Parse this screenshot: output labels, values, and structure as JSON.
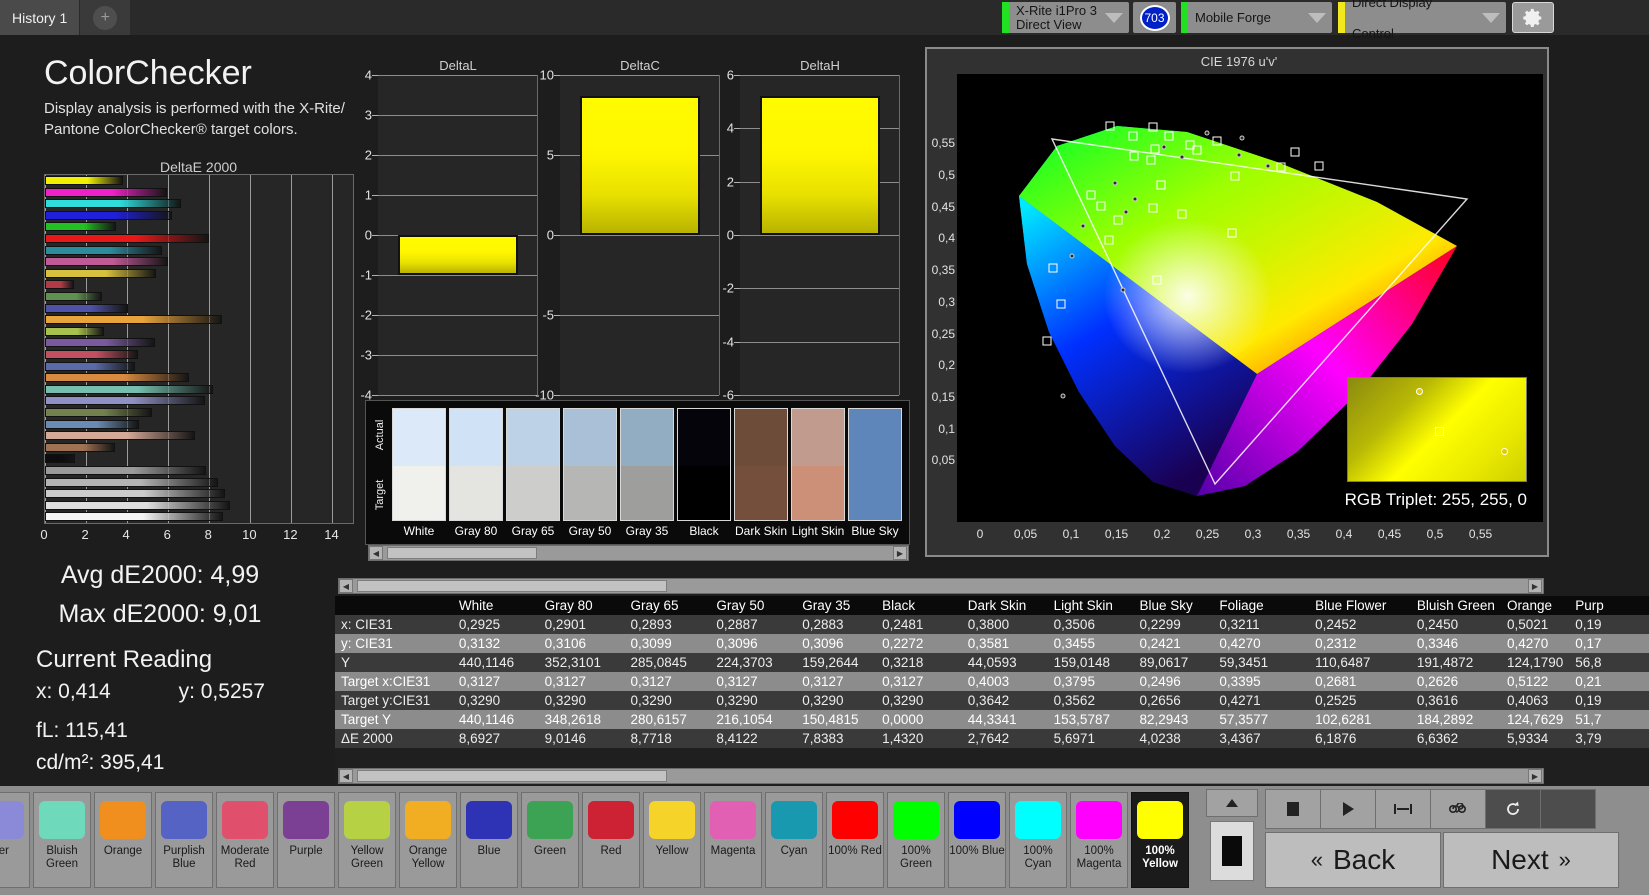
{
  "topbar": {
    "tab_label": "History 1",
    "add_tab_label": "+",
    "device": {
      "line1": "X-Rite i1Pro 3",
      "line2": "Direct View",
      "serial": "703"
    },
    "pattern_source": "Mobile Forge",
    "display_control": "Direct Display Control",
    "gear_icon": "gear-icon"
  },
  "left": {
    "title": "ColorChecker",
    "subtitle": "Display analysis is performed with the X-Rite/ Pantone ColorChecker® target colors.",
    "avg_de2000": "Avg dE2000: 4,99",
    "max_de2000": "Max dE2000: 9,01",
    "current_reading_label": "Current Reading",
    "x_label": "x: 0,414",
    "y_label": "y: 0,5257",
    "fl_label": "fL: 115,41",
    "cd_label": "cd/m²: 395,41"
  },
  "chart_data": [
    {
      "type": "bar",
      "orientation": "horizontal",
      "title": "DeltaE 2000",
      "xlabel": "",
      "ylabel": "",
      "xlim": [
        0,
        15
      ],
      "ticks": [
        0,
        2,
        4,
        6,
        8,
        10,
        12,
        14
      ],
      "grid": true,
      "categories": [
        "100% Yellow",
        "100% Magenta",
        "100% Cyan",
        "100% Blue",
        "100% Green",
        "100% Red",
        "Cyan",
        "Magenta",
        "Yellow",
        "Red",
        "Green",
        "Blue",
        "Orange Yellow",
        "Yellow Green",
        "Purple",
        "Moderate Red",
        "Purplish Blue",
        "Orange",
        "Bluish Green",
        "Blue Flower",
        "Foliage",
        "Blue Sky",
        "Light Skin",
        "Dark Skin",
        "Black",
        "Gray 35",
        "Gray 50",
        "Gray 65",
        "Gray 80",
        "White"
      ],
      "values": [
        3.79,
        5.93,
        6.64,
        6.19,
        3.44,
        8.0,
        5.7,
        6.0,
        5.4,
        1.43,
        2.76,
        4.02,
        8.6,
        2.85,
        5.35,
        4.55,
        4.4,
        7.0,
        8.2,
        7.8,
        5.2,
        4.6,
        7.3,
        3.4,
        1.45,
        7.84,
        8.41,
        8.77,
        9.01,
        8.69
      ],
      "bar_colors": [
        "#f0f000",
        "#f020c8",
        "#30dcdc",
        "#2020d8",
        "#22c022",
        "#e81818",
        "#2d8b9e",
        "#c05a96",
        "#d6c03e",
        "#b03a46",
        "#5f9050",
        "#4f52a8",
        "#e8a33d",
        "#a8c04d",
        "#7a5a9e",
        "#c15060",
        "#5a6aa8",
        "#d88a40",
        "#76bfae",
        "#8f90c4",
        "#73814e",
        "#6a8cb4",
        "#d4a998",
        "#a07254",
        "#0d0d0d",
        "#9a9a9a",
        "#b4b4b4",
        "#cccccc",
        "#dedede",
        "#f4f4f4"
      ]
    },
    {
      "type": "bar",
      "title": "DeltaL",
      "ylim": [
        -4,
        4
      ],
      "ticks": [
        4,
        3,
        2,
        1,
        0,
        -1,
        -2,
        -3,
        -4
      ],
      "values": [
        -1.0
      ],
      "bar_color": "#fff000"
    },
    {
      "type": "bar",
      "title": "DeltaC",
      "ylim": [
        -10,
        10
      ],
      "ticks": [
        10,
        5,
        0,
        -5,
        -10
      ],
      "values": [
        8.7
      ],
      "bar_color": "#fff000"
    },
    {
      "type": "bar",
      "title": "DeltaH",
      "ylim": [
        -6,
        6
      ],
      "ticks": [
        6,
        4,
        2,
        0,
        -2,
        -4,
        -6
      ],
      "values": [
        5.2
      ],
      "bar_color": "#fff000"
    },
    {
      "type": "scatter",
      "title": "CIE 1976 u'v'",
      "xlabel": "",
      "ylabel": "",
      "xticks": [
        "0",
        "0,05",
        "0,1",
        "0,15",
        "0,2",
        "0,25",
        "0,3",
        "0,35",
        "0,4",
        "0,45",
        "0,5",
        "0,55"
      ],
      "yticks": [
        "0,55",
        "0,5",
        "0,45",
        "0,4",
        "0,35",
        "0,3",
        "0,25",
        "0,2",
        "0,15",
        "0,1",
        "0,05"
      ],
      "rgb_triplet_label": "RGB Triplet: 255, 255, 0",
      "measured_points": [
        [
          0.148,
          0.578
        ],
        [
          0.196,
          0.576
        ],
        [
          0.255,
          0.566
        ],
        [
          0.174,
          0.561
        ],
        [
          0.213,
          0.561
        ],
        [
          0.293,
          0.559
        ],
        [
          0.266,
          0.554
        ],
        [
          0.236,
          0.548
        ],
        [
          0.208,
          0.545
        ],
        [
          0.198,
          0.541
        ],
        [
          0.244,
          0.54
        ],
        [
          0.29,
          0.531
        ],
        [
          0.352,
          0.537
        ],
        [
          0.175,
          0.53
        ],
        [
          0.228,
          0.529
        ],
        [
          0.193,
          0.524
        ],
        [
          0.378,
          0.515
        ],
        [
          0.322,
          0.514
        ],
        [
          0.336,
          0.512
        ],
        [
          0.286,
          0.498
        ],
        [
          0.154,
          0.487
        ],
        [
          0.204,
          0.484
        ],
        [
          0.127,
          0.468
        ],
        [
          0.176,
          0.462
        ],
        [
          0.138,
          0.451
        ],
        [
          0.196,
          0.448
        ],
        [
          0.166,
          0.441
        ],
        [
          0.227,
          0.438
        ],
        [
          0.157,
          0.429
        ],
        [
          0.119,
          0.42
        ],
        [
          0.282,
          0.409
        ],
        [
          0.147,
          0.397
        ],
        [
          0.107,
          0.372
        ],
        [
          0.086,
          0.353
        ],
        [
          0.2,
          0.335
        ],
        [
          0.163,
          0.318
        ],
        [
          0.094,
          0.296
        ],
        [
          0.079,
          0.238
        ],
        [
          0.097,
          0.151
        ]
      ]
    }
  ],
  "patch_strip": {
    "actual_label": "Actual",
    "target_label": "Target",
    "patches": [
      {
        "name": "White",
        "actual": "#dbe9f8",
        "target": "#f0f0ec"
      },
      {
        "name": "Gray 80",
        "actual": "#cfe2f6",
        "target": "#e4e4e0"
      },
      {
        "name": "Gray 65",
        "actual": "#bdd2e6",
        "target": "#cdcdcb"
      },
      {
        "name": "Gray 50",
        "actual": "#a9c0d6",
        "target": "#b6b6b4"
      },
      {
        "name": "Gray 35",
        "actual": "#92adc1",
        "target": "#9e9e9c"
      },
      {
        "name": "Black",
        "actual": "#04040a",
        "target": "#000000"
      },
      {
        "name": "Dark Skin",
        "actual": "#6e4c3a",
        "target": "#74503c"
      },
      {
        "name": "Light Skin",
        "actual": "#c19b8d",
        "target": "#cc9078"
      },
      {
        "name": "Blue Sky",
        "actual": "#5f86ba",
        "target": "#5f86ba"
      }
    ]
  },
  "table": {
    "columns": [
      "White",
      "Gray 80",
      "Gray 65",
      "Gray 50",
      "Gray 35",
      "Black",
      "Dark Skin",
      "Light Skin",
      "Blue Sky",
      "Foliage",
      "Blue Flower",
      "Bluish Green",
      "Orange",
      "Purp"
    ],
    "rows": [
      {
        "label": "x: CIE31",
        "values": [
          "0,2925",
          "0,2901",
          "0,2893",
          "0,2887",
          "0,2883",
          "0,2481",
          "0,3800",
          "0,3506",
          "0,2299",
          "0,3211",
          "0,2452",
          "0,2450",
          "0,5021",
          "0,19"
        ]
      },
      {
        "label": "y: CIE31",
        "values": [
          "0,3132",
          "0,3106",
          "0,3099",
          "0,3096",
          "0,3096",
          "0,2272",
          "0,3581",
          "0,3455",
          "0,2421",
          "0,4270",
          "0,2312",
          "0,3346",
          "0,4270",
          "0,17"
        ]
      },
      {
        "label": "Y",
        "values": [
          "440,1146",
          "352,3101",
          "285,0845",
          "224,3703",
          "159,2644",
          "0,3218",
          "44,0593",
          "159,0148",
          "89,0617",
          "59,3451",
          "110,6487",
          "191,4872",
          "124,1790",
          "56,8"
        ]
      },
      {
        "label": "Target x:CIE31",
        "values": [
          "0,3127",
          "0,3127",
          "0,3127",
          "0,3127",
          "0,3127",
          "0,3127",
          "0,4003",
          "0,3795",
          "0,2496",
          "0,3395",
          "0,2681",
          "0,2626",
          "0,5122",
          "0,21"
        ]
      },
      {
        "label": "Target y:CIE31",
        "values": [
          "0,3290",
          "0,3290",
          "0,3290",
          "0,3290",
          "0,3290",
          "0,3290",
          "0,3642",
          "0,3562",
          "0,2656",
          "0,4271",
          "0,2525",
          "0,3616",
          "0,4063",
          "0,19"
        ]
      },
      {
        "label": "Target Y",
        "values": [
          "440,1146",
          "348,2618",
          "280,6157",
          "216,1054",
          "150,4815",
          "0,0000",
          "44,3341",
          "153,5787",
          "82,2943",
          "57,3577",
          "102,6281",
          "184,2892",
          "124,7629",
          "51,7"
        ]
      },
      {
        "label": "ΔE 2000",
        "values": [
          "8,6927",
          "9,0146",
          "8,7718",
          "8,4122",
          "7,8383",
          "1,4320",
          "2,7642",
          "5,6971",
          "4,0238",
          "3,4367",
          "6,1876",
          "6,6362",
          "5,9334",
          "3,79"
        ]
      }
    ]
  },
  "bottom": {
    "swatches": [
      {
        "name": "ver",
        "color": "#8a8ad8",
        "selected": false
      },
      {
        "name": "Bluish Green",
        "color": "#6fd9bb",
        "selected": false
      },
      {
        "name": "Orange",
        "color": "#f08f1e",
        "selected": false
      },
      {
        "name": "Purplish Blue",
        "color": "#5463c4",
        "selected": false
      },
      {
        "name": "Moderate Red",
        "color": "#e04f6b",
        "selected": false
      },
      {
        "name": "Purple",
        "color": "#7b3f94",
        "selected": false
      },
      {
        "name": "Yellow Green",
        "color": "#b6d143",
        "selected": false
      },
      {
        "name": "Orange Yellow",
        "color": "#f2ae22",
        "selected": false
      },
      {
        "name": "Blue",
        "color": "#2e32b4",
        "selected": false
      },
      {
        "name": "Green",
        "color": "#3ba353",
        "selected": false
      },
      {
        "name": "Red",
        "color": "#cc2233",
        "selected": false
      },
      {
        "name": "Yellow",
        "color": "#f5d328",
        "selected": false
      },
      {
        "name": "Magenta",
        "color": "#e160b4",
        "selected": false
      },
      {
        "name": "Cyan",
        "color": "#1899b0",
        "selected": false
      },
      {
        "name": "100% Red",
        "color": "#ff0000",
        "selected": false
      },
      {
        "name": "100% Green",
        "color": "#00ff00",
        "selected": false
      },
      {
        "name": "100% Blue",
        "color": "#0000ff",
        "selected": false
      },
      {
        "name": "100% Cyan",
        "color": "#00ffff",
        "selected": false
      },
      {
        "name": "100% Magenta",
        "color": "#ff00ff",
        "selected": false
      },
      {
        "name": "100% Yellow",
        "color": "#ffff00",
        "selected": true
      }
    ],
    "controls": {
      "up_icon": "chevron-up-icon",
      "black_swatch": "black-patch-button",
      "stop_icon": "stop-icon",
      "play_icon": "play-icon",
      "measure_icon": "measure-icon",
      "loop_icon": "infinity-icon",
      "refresh_icon": "refresh-icon",
      "back_label": "Back",
      "next_label": "Next",
      "back_chevron": "«",
      "next_chevron": "»"
    }
  }
}
